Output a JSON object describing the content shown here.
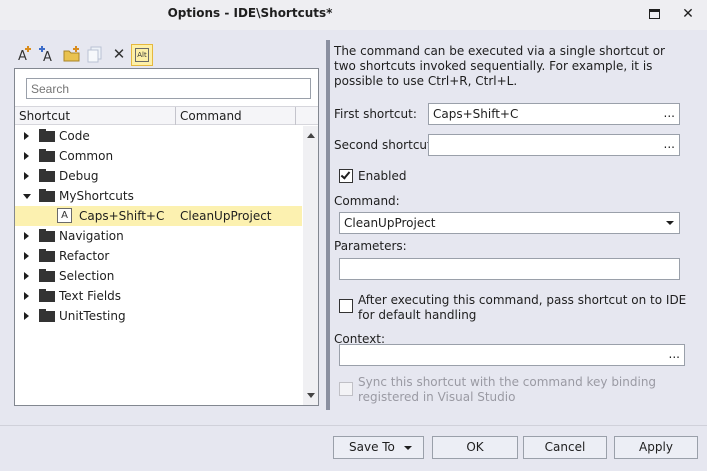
{
  "window": {
    "title": "Options - IDE\\Shortcuts*",
    "maximize_icon": "maximize-icon",
    "close_glyph": "✕"
  },
  "toolbar": {
    "icons": [
      "add-shortcut-icon",
      "add-shortcut-alt-icon",
      "add-folder-icon",
      "copy-icon",
      "delete-icon",
      "alt-toggle-icon"
    ],
    "delete_glyph": "✕",
    "alt_label": "Alt"
  },
  "tree": {
    "search_placeholder": "Search",
    "columns": [
      "Shortcut",
      "Command"
    ],
    "rows": [
      {
        "type": "folder",
        "label": "Code",
        "expanded": false
      },
      {
        "type": "folder",
        "label": "Common",
        "expanded": false
      },
      {
        "type": "folder",
        "label": "Debug",
        "expanded": false
      },
      {
        "type": "folder",
        "label": "MyShortcuts",
        "expanded": true
      },
      {
        "type": "shortcut",
        "label": "Caps+Shift+C",
        "command": "CleanUpProject",
        "selected": true,
        "icon_text": "A"
      },
      {
        "type": "folder",
        "label": "Navigation",
        "expanded": false
      },
      {
        "type": "folder",
        "label": "Refactor",
        "expanded": false
      },
      {
        "type": "folder",
        "label": "Selection",
        "expanded": false
      },
      {
        "type": "folder",
        "label": "Text Fields",
        "expanded": false
      },
      {
        "type": "folder",
        "label": "UnitTesting",
        "expanded": false
      }
    ]
  },
  "details": {
    "description": "The command can be executed via a single shortcut or two shortcuts invoked sequentially. For example, it is possible to use Ctrl+R, Ctrl+L.",
    "first_shortcut_label": "First shortcut:",
    "first_shortcut_value": "Caps+Shift+C",
    "second_shortcut_label": "Second shortcut:",
    "second_shortcut_value": "",
    "browse_label": "...",
    "enabled_label": "Enabled",
    "enabled_checked": true,
    "command_label": "Command:",
    "command_value": "CleanUpProject",
    "parameters_label": "Parameters:",
    "parameters_value": "",
    "pass_shortcut_label": "After executing this command, pass shortcut on to IDE for default handling",
    "pass_shortcut_checked": false,
    "context_label": "Context:",
    "context_value": "",
    "sync_label": "Sync this shortcut with the command key binding registered in Visual Studio",
    "sync_checked": false
  },
  "buttons": {
    "save_to": "Save To",
    "ok": "OK",
    "cancel": "Cancel",
    "apply": "Apply"
  },
  "colors": {
    "selected_row": "#fcf1b0",
    "alt_button_bg": "#fdf0a7",
    "window_bg": "#e6e7f0"
  }
}
